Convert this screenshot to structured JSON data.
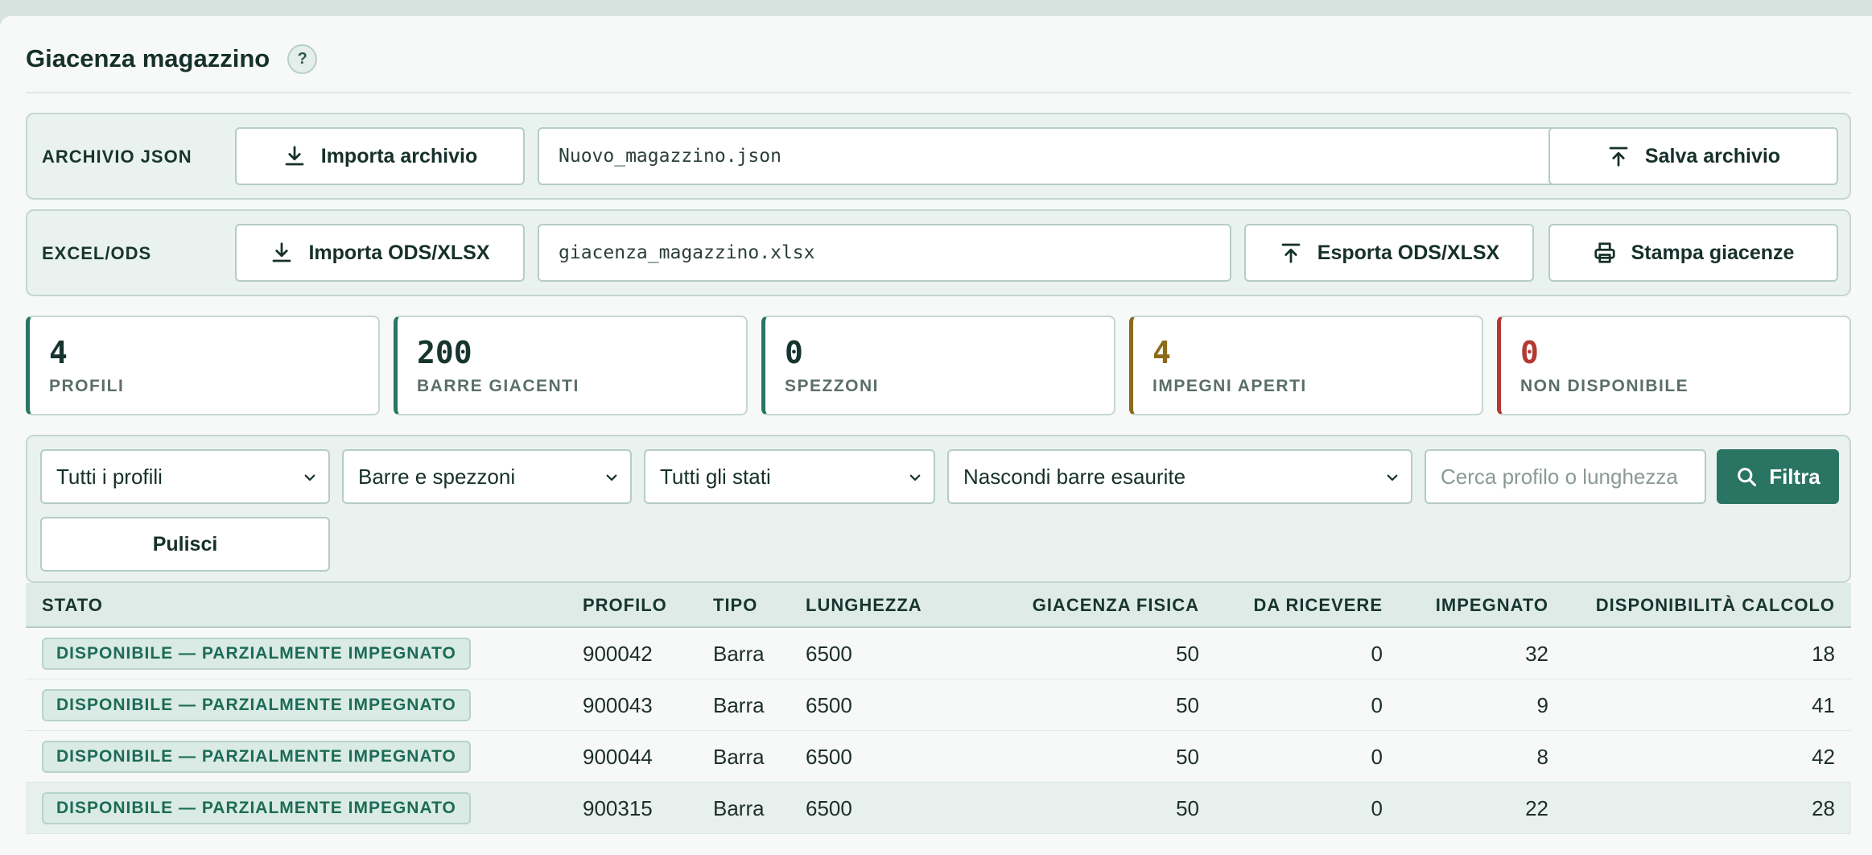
{
  "header": {
    "title": "Giacenza magazzino",
    "help_label": "?"
  },
  "json_archive": {
    "label": "ARCHIVIO JSON",
    "import_label": "Importa archivio",
    "filename": "Nuovo_magazzino.json",
    "save_label": "Salva archivio"
  },
  "excel": {
    "label": "EXCEL/ODS",
    "import_label": "Importa ODS/XLSX",
    "filename": "giacenza_magazzino.xlsx",
    "export_label": "Esporta ODS/XLSX",
    "print_label": "Stampa giacenze"
  },
  "stats": [
    {
      "value": "4",
      "label": "PROFILI",
      "color": "#17352e",
      "accent": "#2a7463"
    },
    {
      "value": "200",
      "label": "BARRE GIACENTI",
      "color": "#17352e",
      "accent": "#2a7463"
    },
    {
      "value": "0",
      "label": "SPEZZONI",
      "color": "#17352e",
      "accent": "#2a7463"
    },
    {
      "value": "4",
      "label": "IMPEGNI APERTI",
      "color": "#8b6a1a",
      "accent": "#8b6a1a"
    },
    {
      "value": "0",
      "label": "NON DISPONIBILE",
      "color": "#b23a32",
      "accent": "#b23a32"
    }
  ],
  "filters": {
    "profile": "Tutti i profili",
    "type": "Barre e spezzoni",
    "status": "Tutti gli stati",
    "exhausted": "Nascondi barre esaurite",
    "search_placeholder": "Cerca profilo o lunghezza",
    "filter_label": "Filtra",
    "clear_label": "Pulisci"
  },
  "table": {
    "columns": [
      "STATO",
      "PROFILO",
      "TIPO",
      "LUNGHEZZA",
      "GIACENZA FISICA",
      "DA RICEVERE",
      "IMPEGNATO",
      "DISPONIBILITÀ CALCOLO"
    ],
    "rows": [
      {
        "status": "DISPONIBILE — PARZIALMENTE IMPEGNATO",
        "profile": "900042",
        "type": "Barra",
        "length": "6500",
        "stock": "50",
        "incoming": "0",
        "committed": "32",
        "available": "18"
      },
      {
        "status": "DISPONIBILE — PARZIALMENTE IMPEGNATO",
        "profile": "900043",
        "type": "Barra",
        "length": "6500",
        "stock": "50",
        "incoming": "0",
        "committed": "9",
        "available": "41"
      },
      {
        "status": "DISPONIBILE — PARZIALMENTE IMPEGNATO",
        "profile": "900044",
        "type": "Barra",
        "length": "6500",
        "stock": "50",
        "incoming": "0",
        "committed": "8",
        "available": "42"
      },
      {
        "status": "DISPONIBILE — PARZIALMENTE IMPEGNATO",
        "profile": "900315",
        "type": "Barra",
        "length": "6500",
        "stock": "50",
        "incoming": "0",
        "committed": "22",
        "available": "28"
      }
    ]
  },
  "colors": {
    "accent": "#2a7463",
    "warning": "#8b6a1a",
    "danger": "#b23a32"
  }
}
